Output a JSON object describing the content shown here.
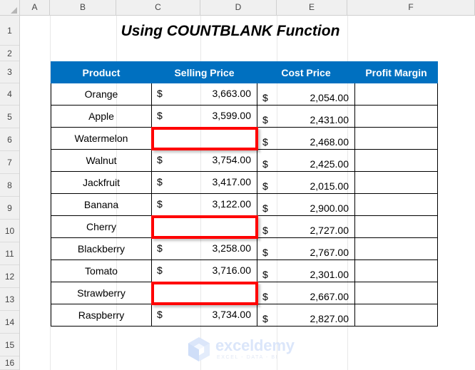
{
  "spreadsheet": {
    "column_headers": [
      "A",
      "B",
      "C",
      "D",
      "E",
      "F"
    ],
    "row_headers": [
      "1",
      "2",
      "3",
      "4",
      "5",
      "6",
      "7",
      "8",
      "9",
      "10",
      "11",
      "12",
      "13",
      "14",
      "15",
      "16"
    ],
    "title": "Using COUNTBLANK Function",
    "header_color": "#0070C0",
    "highlight_color": "#FF0000"
  },
  "table": {
    "columns": [
      "Product",
      "Selling Price",
      "Cost Price",
      "Profit Margin"
    ],
    "currency_symbol": "$",
    "rows": [
      {
        "product": "Orange",
        "selling_price": "3,663.00",
        "cost_price": "2,054.00",
        "profit_margin": "",
        "selling_blank": false
      },
      {
        "product": "Apple",
        "selling_price": "3,599.00",
        "cost_price": "2,431.00",
        "profit_margin": "",
        "selling_blank": false
      },
      {
        "product": "Watermelon",
        "selling_price": "",
        "cost_price": "2,468.00",
        "profit_margin": "",
        "selling_blank": true
      },
      {
        "product": "Walnut",
        "selling_price": "3,754.00",
        "cost_price": "2,425.00",
        "profit_margin": "",
        "selling_blank": false
      },
      {
        "product": "Jackfruit",
        "selling_price": "3,417.00",
        "cost_price": "2,015.00",
        "profit_margin": "",
        "selling_blank": false
      },
      {
        "product": "Banana",
        "selling_price": "3,122.00",
        "cost_price": "2,900.00",
        "profit_margin": "",
        "selling_blank": false
      },
      {
        "product": "Cherry",
        "selling_price": "",
        "cost_price": "2,727.00",
        "profit_margin": "",
        "selling_blank": true
      },
      {
        "product": "Blackberry",
        "selling_price": "3,258.00",
        "cost_price": "2,767.00",
        "profit_margin": "",
        "selling_blank": false
      },
      {
        "product": "Tomato",
        "selling_price": "3,716.00",
        "cost_price": "2,301.00",
        "profit_margin": "",
        "selling_blank": false
      },
      {
        "product": "Strawberry",
        "selling_price": "",
        "cost_price": "2,667.00",
        "profit_margin": "",
        "selling_blank": true
      },
      {
        "product": "Raspberry",
        "selling_price": "3,734.00",
        "cost_price": "2,827.00",
        "profit_margin": "",
        "selling_blank": false
      }
    ]
  },
  "watermark": {
    "name": "exceldemy",
    "tagline": "EXCEL - DATA - BI",
    "logo_icon": "hexagon-cube-logo-icon"
  }
}
